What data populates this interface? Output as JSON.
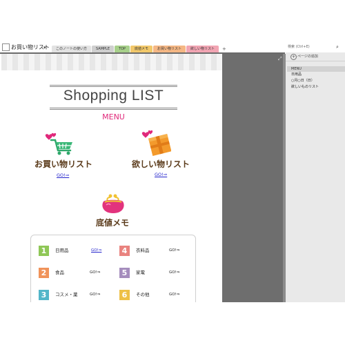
{
  "window": {
    "notebook_title": "お買い物リスト",
    "notebook_arrow": "▾"
  },
  "tabs": [
    {
      "label": "このノートの使い方",
      "color": "#e2e2e2"
    },
    {
      "label": "SAMPLE",
      "color": "#cfcfcf"
    },
    {
      "label": "TOP",
      "color": "#a7d08a"
    },
    {
      "label": "底値メモ",
      "color": "#f2c86a"
    },
    {
      "label": "お買い物リスト",
      "color": "#f5b784"
    },
    {
      "label": "欲しい物リスト",
      "color": "#f2a5b3"
    }
  ],
  "tab_add": "+",
  "search": {
    "placeholder": "検索 (Ctrl+E)",
    "icon": "search-icon"
  },
  "page": {
    "title": "Shopping LIST",
    "menu": "MENU",
    "items": [
      {
        "label": "お買い物リスト",
        "go": "GO!⇒",
        "icon": "shopping-cart-icon"
      },
      {
        "label": "欲しい物リスト",
        "go": "GO!⇒",
        "icon": "gift-box-icon"
      },
      {
        "label": "底値メモ",
        "icon": "coin-purse-icon"
      }
    ],
    "categories": [
      {
        "num": "1",
        "label": "日用品",
        "go": "GO!⇒",
        "color": "#8fc757",
        "link": true
      },
      {
        "num": "2",
        "label": "食品",
        "go": "GO!⇒",
        "color": "#f0935a",
        "link": false
      },
      {
        "num": "3",
        "label": "コスメ・薬",
        "go": "GO!⇒",
        "color": "#52b6c9",
        "link": false
      },
      {
        "num": "4",
        "label": "衣料品",
        "go": "GO!⇒",
        "color": "#e9837f",
        "link": false
      },
      {
        "num": "5",
        "label": "家電",
        "go": "GO!⇒",
        "color": "#a58dbd",
        "link": false
      },
      {
        "num": "6",
        "label": "その他",
        "go": "GO!⇒",
        "color": "#eec046",
        "link": false
      }
    ]
  },
  "right_pane": {
    "add_page": "ページの追加",
    "add_icon": "+",
    "pages": [
      "MENU",
      "日用品",
      "○月○日（日）",
      "欲しいものリスト"
    ]
  },
  "colors": {
    "accent_pink": "#e0287a",
    "label_brown": "#5a3a1a",
    "link_blue": "#2222cc"
  }
}
